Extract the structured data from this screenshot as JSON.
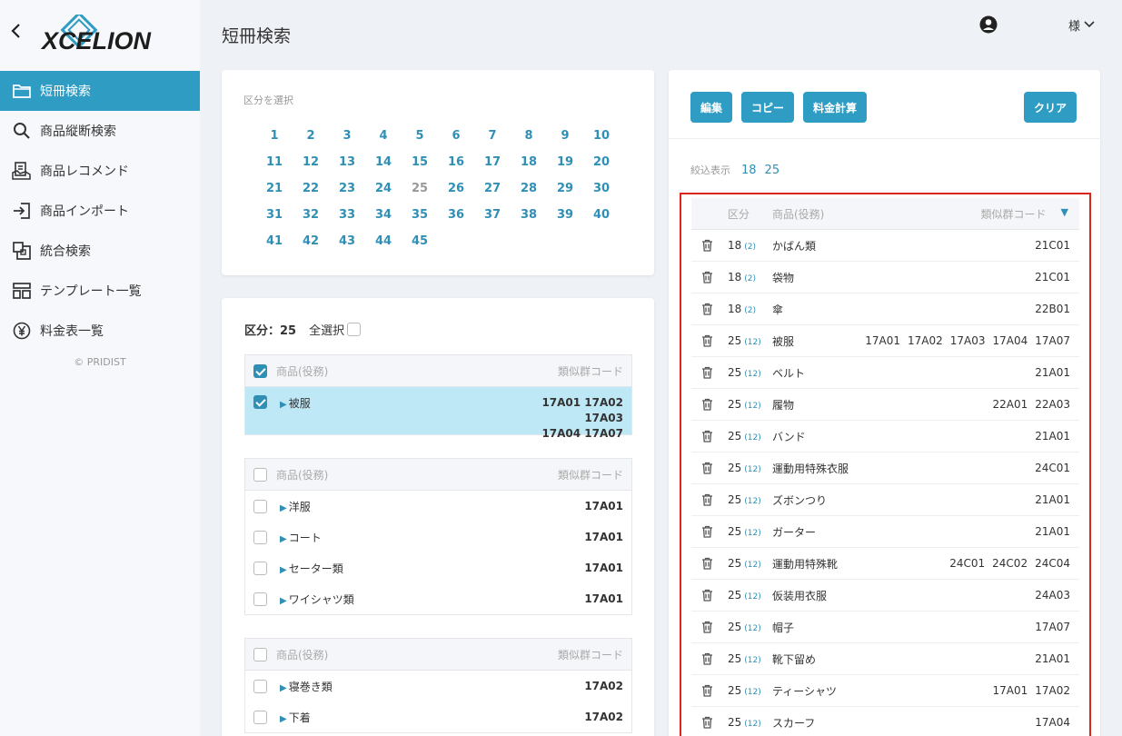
{
  "sidebar": {
    "logo_text": "XCELION",
    "items": [
      {
        "label": "短冊検索",
        "icon": "folder-icon",
        "active": true
      },
      {
        "label": "商品縦断検索",
        "icon": "search-icon",
        "active": false
      },
      {
        "label": "商品レコメンド",
        "icon": "recommend-icon",
        "active": false
      },
      {
        "label": "商品インポート",
        "icon": "import-icon",
        "active": false
      },
      {
        "label": "統合検索",
        "icon": "merge-icon",
        "active": false
      },
      {
        "label": "テンプレート一覧",
        "icon": "template-icon",
        "active": false
      },
      {
        "label": "料金表一覧",
        "icon": "yen-icon",
        "active": false
      }
    ],
    "copyright": "© PRIDIST"
  },
  "header": {
    "title": "短冊検索",
    "user_suffix": "様"
  },
  "class_select": {
    "label": "区分を選択",
    "numbers": [
      "1",
      "2",
      "3",
      "4",
      "5",
      "6",
      "7",
      "8",
      "9",
      "10",
      "11",
      "12",
      "13",
      "14",
      "15",
      "16",
      "17",
      "18",
      "19",
      "20",
      "21",
      "22",
      "23",
      "24",
      "25",
      "26",
      "27",
      "28",
      "29",
      "30",
      "31",
      "32",
      "33",
      "34",
      "35",
      "36",
      "37",
      "38",
      "39",
      "40",
      "41",
      "42",
      "43",
      "44",
      "45"
    ],
    "selected": "25"
  },
  "goods": {
    "class_label": "区分：25",
    "select_all": "全選択",
    "col_goods": "商品(役務)",
    "col_code": "類似群コード",
    "groups": [
      {
        "checked": true,
        "rows": [
          {
            "name": "被服",
            "codes": [
              "17A01 17A02 17A03",
              "17A04 17A07"
            ],
            "checked": true
          }
        ]
      },
      {
        "checked": false,
        "rows": [
          {
            "name": "洋服",
            "codes": [
              "17A01"
            ],
            "checked": false
          },
          {
            "name": "コート",
            "codes": [
              "17A01"
            ],
            "checked": false
          },
          {
            "name": "セーター類",
            "codes": [
              "17A01"
            ],
            "checked": false
          },
          {
            "name": "ワイシャツ類",
            "codes": [
              "17A01"
            ],
            "checked": false
          }
        ]
      },
      {
        "checked": false,
        "rows": [
          {
            "name": "寝巻き類",
            "codes": [
              "17A02"
            ],
            "checked": false
          },
          {
            "name": "下着",
            "codes": [
              "17A02"
            ],
            "checked": false
          }
        ]
      }
    ]
  },
  "toolbar": {
    "edit": "編集",
    "copy": "コピー",
    "fee": "料金計算",
    "clear": "クリア"
  },
  "filter": {
    "label": "絞込表示",
    "values": [
      "18",
      "25"
    ]
  },
  "selected_table": {
    "col_class": "区分",
    "col_goods": "商品(役務)",
    "col_code": "類似群コード",
    "rows": [
      {
        "cls": "18",
        "count": "(2)",
        "name": "かばん類",
        "codes": [
          "21C01"
        ]
      },
      {
        "cls": "18",
        "count": "(2)",
        "name": "袋物",
        "codes": [
          "21C01"
        ]
      },
      {
        "cls": "18",
        "count": "(2)",
        "name": "傘",
        "codes": [
          "22B01"
        ]
      },
      {
        "cls": "25",
        "count": "(12)",
        "name": "被服",
        "codes": [
          "17A01",
          "17A02",
          "17A03",
          "17A04",
          "17A07"
        ]
      },
      {
        "cls": "25",
        "count": "(12)",
        "name": "ベルト",
        "codes": [
          "21A01"
        ]
      },
      {
        "cls": "25",
        "count": "(12)",
        "name": "履物",
        "codes": [
          "22A01",
          "22A03"
        ]
      },
      {
        "cls": "25",
        "count": "(12)",
        "name": "バンド",
        "codes": [
          "21A01"
        ]
      },
      {
        "cls": "25",
        "count": "(12)",
        "name": "運動用特殊衣服",
        "codes": [
          "24C01"
        ]
      },
      {
        "cls": "25",
        "count": "(12)",
        "name": "ズボンつり",
        "codes": [
          "21A01"
        ]
      },
      {
        "cls": "25",
        "count": "(12)",
        "name": "ガーター",
        "codes": [
          "21A01"
        ]
      },
      {
        "cls": "25",
        "count": "(12)",
        "name": "運動用特殊靴",
        "codes": [
          "24C01",
          "24C02",
          "24C04"
        ]
      },
      {
        "cls": "25",
        "count": "(12)",
        "name": "仮装用衣服",
        "codes": [
          "24A03"
        ]
      },
      {
        "cls": "25",
        "count": "(12)",
        "name": "帽子",
        "codes": [
          "17A07"
        ]
      },
      {
        "cls": "25",
        "count": "(12)",
        "name": "靴下留め",
        "codes": [
          "21A01"
        ]
      },
      {
        "cls": "25",
        "count": "(12)",
        "name": "ティーシャツ",
        "codes": [
          "17A01",
          "17A02"
        ]
      },
      {
        "cls": "25",
        "count": "(12)",
        "name": "スカーフ",
        "codes": [
          "17A04"
        ]
      }
    ]
  },
  "colors": {
    "accent": "#2f9cc4",
    "highlight": "#bfe8f6",
    "outline": "#d9261c"
  }
}
